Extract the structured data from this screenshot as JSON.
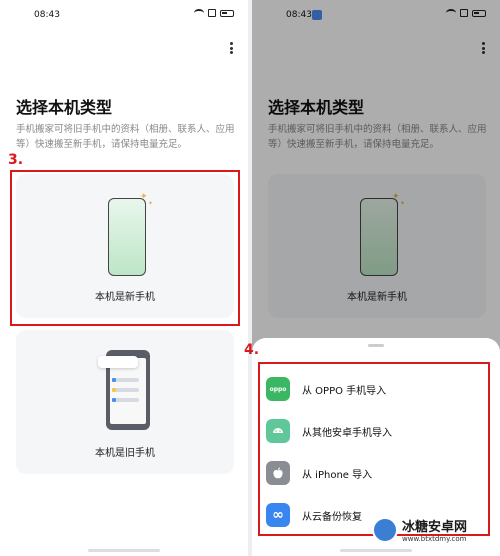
{
  "left_screen": {
    "time": "08:43",
    "title": "选择本机类型",
    "description": "手机搬家可将旧手机中的资料（相册、联系人、应用等）快速搬至新手机，请保持电量充足。",
    "card_new": {
      "label": "本机是新手机"
    },
    "card_old": {
      "label": "本机是旧手机"
    },
    "step_label": "3."
  },
  "right_screen": {
    "time": "08:43",
    "title": "选择本机类型",
    "description": "手机搬家可将旧手机中的资料（相册、联系人、应用等）快速搬至新手机，请保持电量充足。",
    "card_new": {
      "label": "本机是新手机"
    },
    "step_label": "4.",
    "sheet_options": [
      {
        "label": "从 OPPO 手机导入",
        "icon": "oppo-icon",
        "icon_text": "oppo",
        "color": "#3bb764"
      },
      {
        "label": "从其他安卓手机导入",
        "icon": "android-icon",
        "icon_text": "",
        "color": "#5fc79a"
      },
      {
        "label": "从 iPhone 导入",
        "icon": "apple-icon",
        "icon_text": "",
        "color": "#8a8d94"
      },
      {
        "label": "从云备份恢复",
        "icon": "cloud-icon",
        "icon_text": "∞",
        "color": "#3a86f0"
      }
    ]
  },
  "watermark": {
    "title": "冰糖安卓网",
    "url": "www.btxtdmy.com"
  },
  "colors": {
    "highlight": "#d9191c",
    "accent": "#3bb764"
  }
}
